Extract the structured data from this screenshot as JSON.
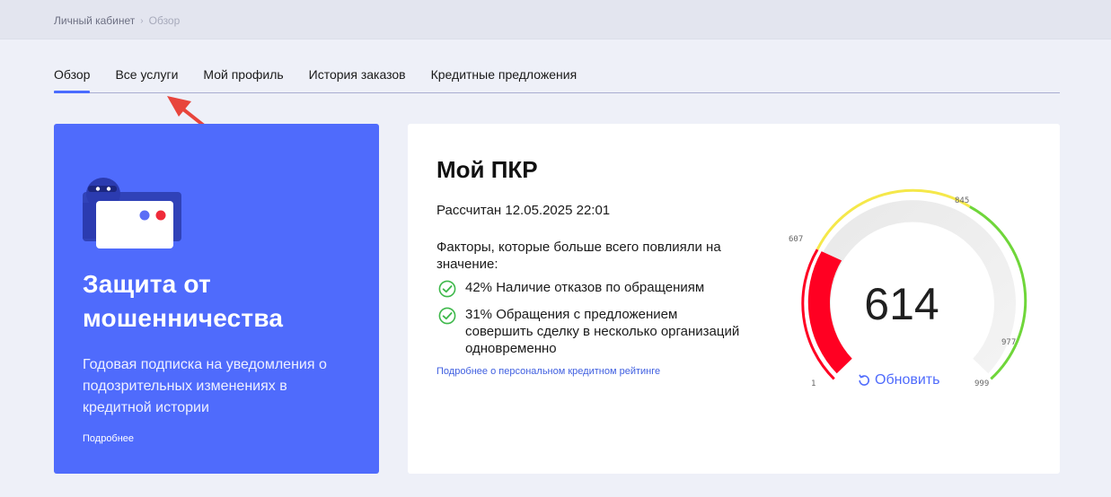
{
  "breadcrumb": {
    "home": "Личный кабинет",
    "current": "Обзор"
  },
  "tabs": [
    {
      "label": "Обзор",
      "active": true
    },
    {
      "label": "Все услуги",
      "active": false
    },
    {
      "label": "Мой профиль",
      "active": false
    },
    {
      "label": "История заказов",
      "active": false
    },
    {
      "label": "Кредитные предложения",
      "active": false
    }
  ],
  "promo": {
    "title": "Защита от мошенничества",
    "description": "Годовая подписка на уведомления о подозрительных изменениях в кредитной истории",
    "link": "Подробнее"
  },
  "pkr": {
    "title": "Мой ПКР",
    "calculated": "Рассчитан 12.05.2025 22:01",
    "factors_heading": "Факторы, которые больше всего повлияли на значение:",
    "factors": [
      {
        "text": "42% Наличие отказов по обращениям"
      },
      {
        "text": "31% Обращения с предложением совершить сделку в несколько организаций одновременно"
      }
    ],
    "more_link": "Подробнее о персональном кредитном рейтинге",
    "gauge": {
      "score": "614",
      "refresh_label": "Обновить",
      "scale": {
        "min": "1",
        "mark1": "607",
        "mark2": "845",
        "mark3": "977",
        "max": "999"
      }
    }
  },
  "colors": {
    "accent": "#4f6bfc",
    "red": "#ff0022",
    "yellow": "#f5e84a",
    "green": "#6fd63a"
  }
}
